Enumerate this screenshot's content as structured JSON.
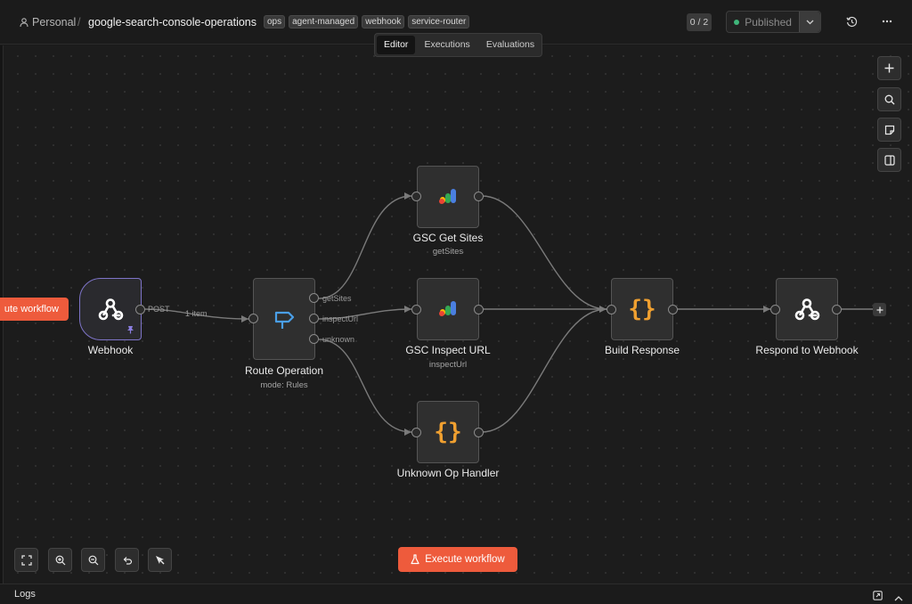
{
  "header": {
    "project": "Personal",
    "separator": "/",
    "workflow_name": "google-search-console-operations",
    "tags": [
      "ops",
      "agent-managed",
      "webhook",
      "service-router"
    ],
    "counter": "0 / 2",
    "publish_label": "Published"
  },
  "tabs": [
    "Editor",
    "Executions",
    "Evaluations"
  ],
  "nodes": {
    "webhook": {
      "title": "Webhook"
    },
    "route": {
      "title": "Route Operation",
      "subtitle": "mode: Rules"
    },
    "gsc_get_sites": {
      "title": "GSC Get Sites",
      "subtitle": "getSites"
    },
    "gsc_inspect_url": {
      "title": "GSC Inspect URL",
      "subtitle": "inspectUrl"
    },
    "unknown_op": {
      "title": "Unknown Op Handler"
    },
    "build_response": {
      "title": "Build Response"
    },
    "respond": {
      "title": "Respond to Webhook"
    }
  },
  "edges": {
    "webhook_port": "POST",
    "item_count": "1 item",
    "route_outputs": [
      "getSites",
      "inspectUrl",
      "unknown"
    ]
  },
  "execute_left_label": "ute workflow",
  "execute_label": "Execute workflow",
  "logs_label": "Logs",
  "colors": {
    "accent": "#ee5b3c",
    "trigger_border": "#7e74c8",
    "published_dot": "#3fb67a",
    "code_brace": "#f0a030",
    "router_icon": "#4a9fe8"
  }
}
